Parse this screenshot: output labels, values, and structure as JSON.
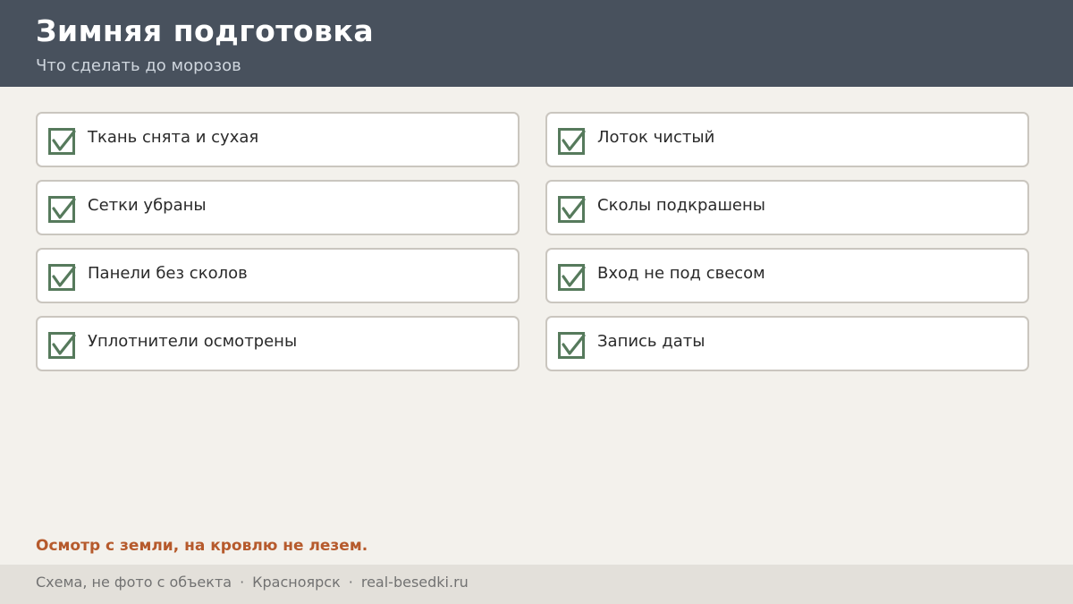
{
  "header": {
    "title": "Зимняя подготовка",
    "subtitle": "Что сделать до морозов"
  },
  "checklist": [
    {
      "label": "Ткань снята и сухая",
      "checked": true
    },
    {
      "label": "Лоток чистый",
      "checked": true
    },
    {
      "label": "Сетки убраны",
      "checked": true
    },
    {
      "label": "Сколы подкрашены",
      "checked": true
    },
    {
      "label": "Панели без сколов",
      "checked": true
    },
    {
      "label": "Вход не под свесом",
      "checked": true
    },
    {
      "label": "Уплотнители осмотрены",
      "checked": true
    },
    {
      "label": "Запись даты",
      "checked": true
    }
  ],
  "note": "Осмотр с земли, на кровлю не лезем.",
  "footer": {
    "disclaimer": "Схема, не фото с объекта",
    "city": "Красноярск",
    "site": "real-besedki.ru",
    "separator": "·"
  },
  "colors": {
    "header_bg": "#48515d",
    "page_bg": "#f3f1ec",
    "check": "#567a5c",
    "note": "#b65a2c",
    "footer_bg": "#e3e0da"
  },
  "icons": {
    "checkbox": "checkbox-checked-icon"
  }
}
